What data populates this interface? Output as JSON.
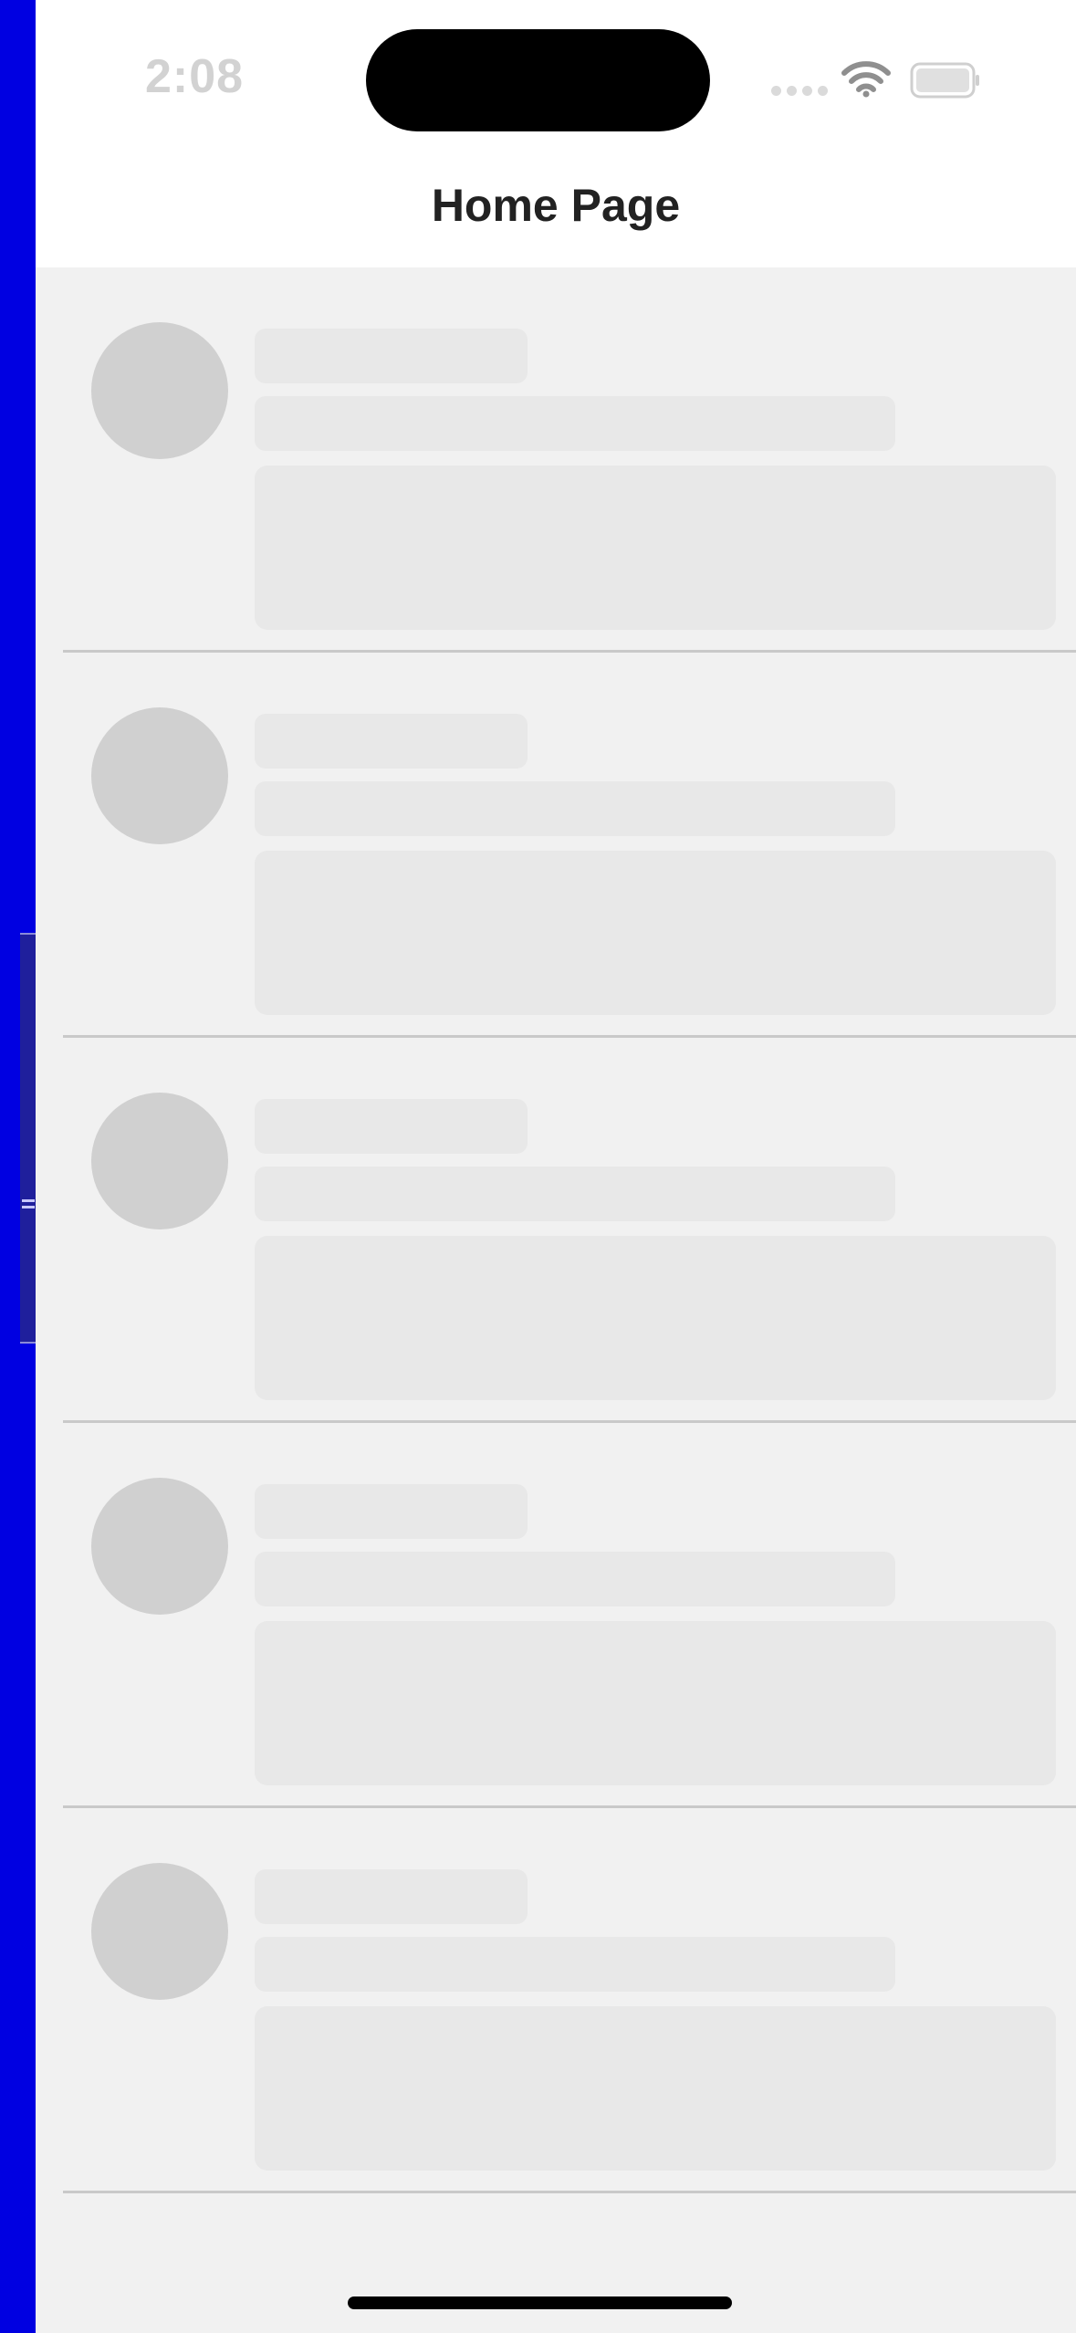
{
  "status_bar": {
    "time": "2:08"
  },
  "header": {
    "title": "Home Page"
  },
  "feed": {
    "state": "loading",
    "placeholder_count": 5
  },
  "colors": {
    "left_bar": "#0000e1",
    "screen_background": "#f1f1f1",
    "header_background": "#ffffff",
    "skeleton": "#e8e8e8",
    "avatar_skeleton": "#d0d0d0",
    "divider": "#c9c9c9"
  },
  "icons": [
    "wifi-icon",
    "battery-icon",
    "signal-icon",
    "drawer-grip-icon"
  ]
}
